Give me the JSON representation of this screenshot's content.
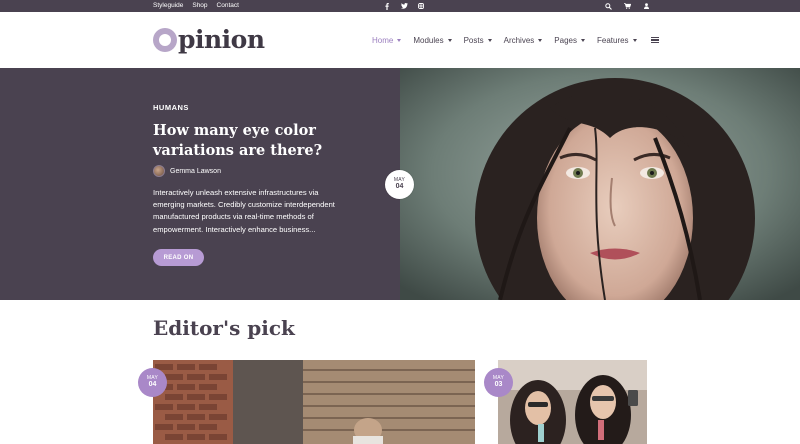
{
  "topbar": {
    "links": [
      "Styleguide",
      "Shop",
      "Contact"
    ],
    "social_icons": [
      "facebook-icon",
      "twitter-icon",
      "instagram-icon"
    ],
    "utility_icons": [
      "search-icon",
      "cart-icon",
      "user-icon"
    ]
  },
  "header": {
    "logo_text": "pinion",
    "nav": [
      {
        "label": "Home",
        "active": true
      },
      {
        "label": "Modules",
        "active": false
      },
      {
        "label": "Posts",
        "active": false
      },
      {
        "label": "Archives",
        "active": false
      },
      {
        "label": "Pages",
        "active": false
      },
      {
        "label": "Features",
        "active": false
      }
    ]
  },
  "hero": {
    "category": "HUMANS",
    "title": "How many eye color variations are there?",
    "author": "Gemma Lawson",
    "excerpt": "Interactively unleash extensive infrastructures via emerging markets. Credibly customize interdependent manufactured products via real-time methods of empowerment. Interactively enhance business...",
    "read_more": "READ ON",
    "date": {
      "month": "MAY",
      "day": "04"
    }
  },
  "editors_pick": {
    "title": "Editor's pick",
    "cards": [
      {
        "date": {
          "month": "MAY",
          "day": "04"
        }
      },
      {
        "date": {
          "month": "MAY",
          "day": "03"
        }
      }
    ]
  },
  "colors": {
    "dark": "#4a4250",
    "accent": "#b79bd4",
    "accent_dark": "#a988c8",
    "nav_active": "#9b7fbf"
  }
}
